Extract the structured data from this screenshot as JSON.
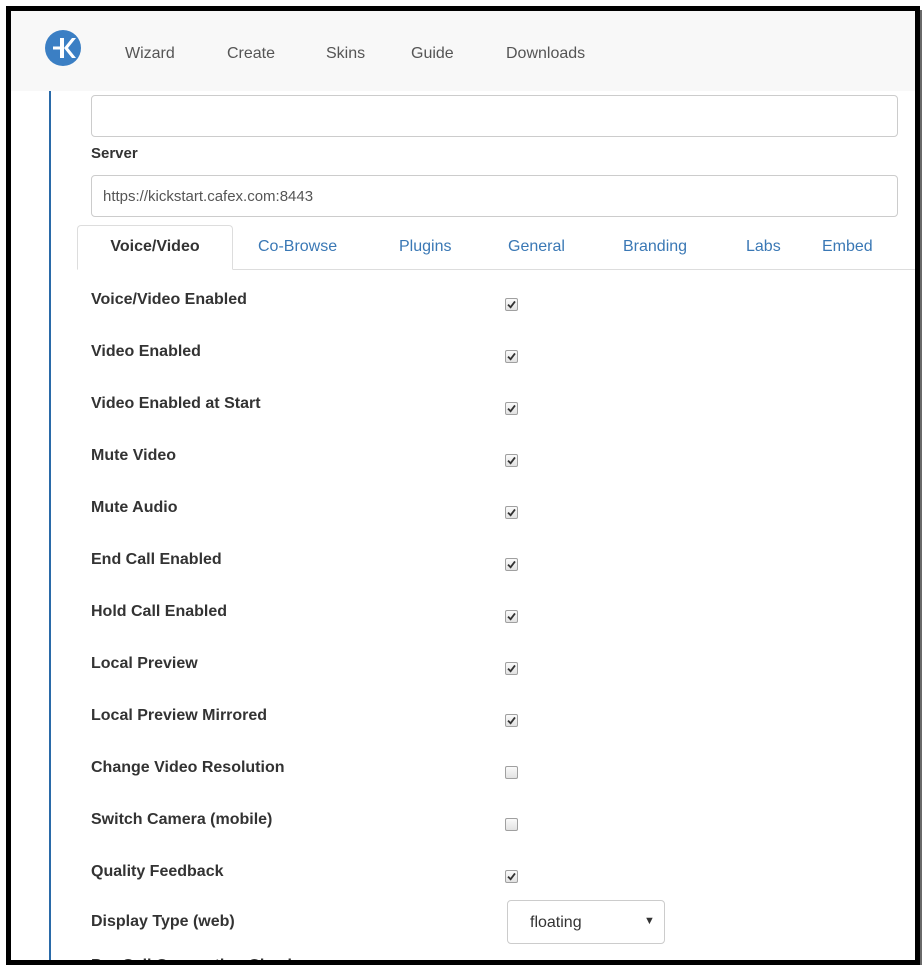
{
  "navbar": {
    "logo_icon": "kickstart-logo",
    "links": [
      "Wizard",
      "Create",
      "Skins",
      "Guide",
      "Downloads"
    ]
  },
  "form": {
    "top_input_value": "",
    "server_label": "Server",
    "server_value": "https://kickstart.cafex.com:8443"
  },
  "tabs": [
    "Voice/Video",
    "Co-Browse",
    "Plugins",
    "General",
    "Branding",
    "Labs",
    "Embed"
  ],
  "active_tab": "Voice/Video",
  "options": [
    {
      "label": "Voice/Video Enabled",
      "checked": true
    },
    {
      "label": "Video Enabled",
      "checked": true
    },
    {
      "label": "Video Enabled at Start",
      "checked": true
    },
    {
      "label": "Mute Video",
      "checked": true
    },
    {
      "label": "Mute Audio",
      "checked": true
    },
    {
      "label": "End Call Enabled",
      "checked": true
    },
    {
      "label": "Hold Call Enabled",
      "checked": true
    },
    {
      "label": "Local Preview",
      "checked": true
    },
    {
      "label": "Local Preview Mirrored",
      "checked": true
    },
    {
      "label": "Change Video Resolution",
      "checked": false
    },
    {
      "label": "Switch Camera (mobile)",
      "checked": false
    },
    {
      "label": "Quality Feedback",
      "checked": true
    }
  ],
  "display_type": {
    "label": "Display Type (web)",
    "value": "floating"
  },
  "partial_next_label": "Pre-Call Connection Check",
  "colors": {
    "link": "#3a78b5",
    "logo": "#3b7fc4",
    "accent_rule": "#2a6aa8"
  }
}
